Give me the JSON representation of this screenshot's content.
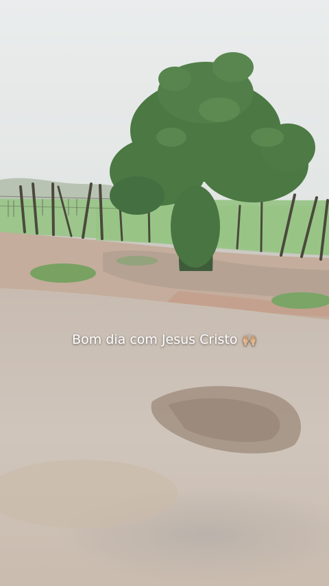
{
  "caption": {
    "text": "Bom dia com Jesus Cristo",
    "emoji": "🙌🏼"
  },
  "colors": {
    "sky": "#e3e7e7",
    "field": "#8fbf7e",
    "road": "#c9bfb5",
    "tree": "#3d6e35",
    "caption_text": "#ffffff"
  },
  "icons": [
    "raised-hands-emoji-icon"
  ]
}
